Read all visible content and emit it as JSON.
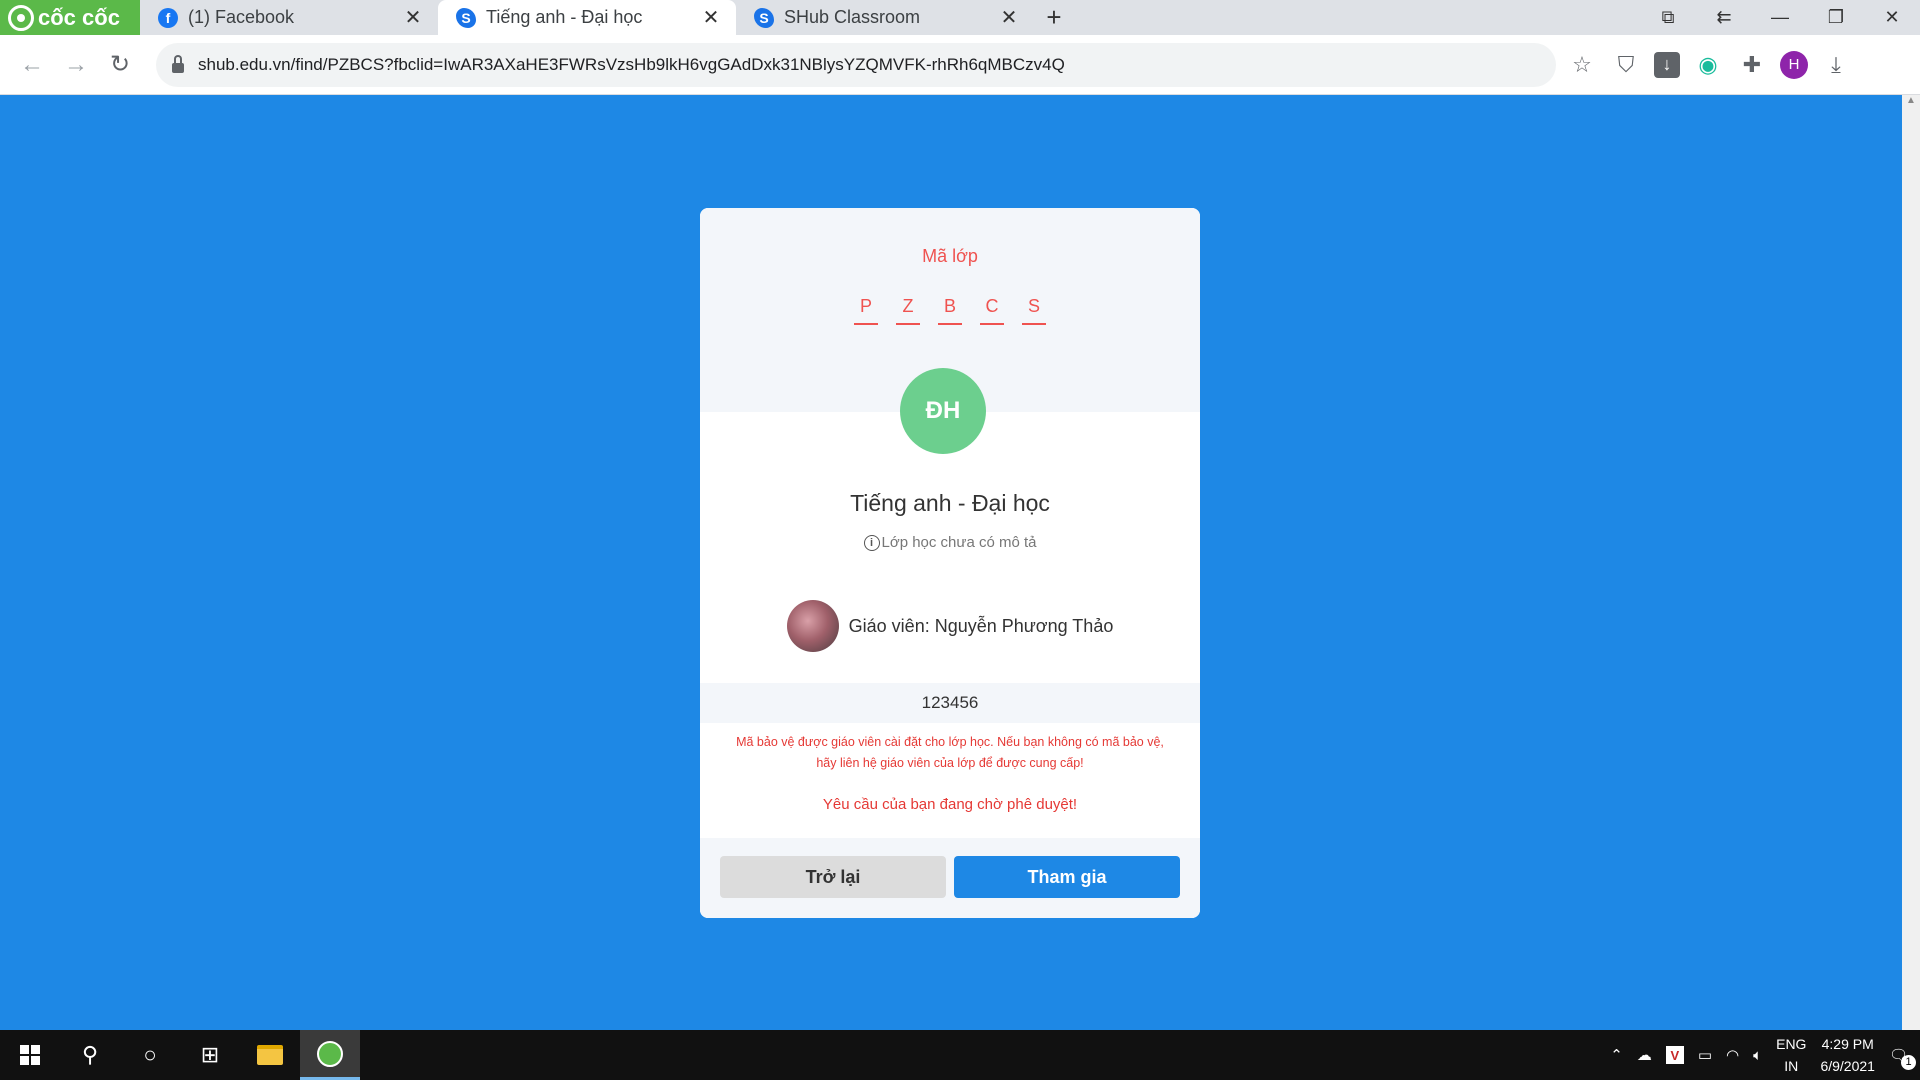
{
  "browser": {
    "brand": "cốc cốc",
    "tabs": [
      {
        "title": "(1) Facebook",
        "favicon": "facebook-icon",
        "active": false
      },
      {
        "title": "Tiếng anh - Đại học",
        "favicon": "shub-icon",
        "active": true
      },
      {
        "title": "SHub Classroom",
        "favicon": "shub-icon",
        "active": false
      }
    ],
    "url": "shub.edu.vn/find/PZBCS?fbclid=IwAR3AXaHE3FWRsVzsHb9lkH6vgGAdDxk31NBlysYZQMVFK-rhRh6qMBCzv4Q",
    "profile_initial": "H",
    "colors": {
      "brand": "#5bb949",
      "page_bg": "#1e88e5"
    }
  },
  "card": {
    "code_label": "Mã lớp",
    "code_chars": [
      "P",
      "Z",
      "B",
      "C",
      "S"
    ],
    "avatar_initials": "ĐH",
    "class_name": "Tiếng anh - Đại học",
    "class_desc": "Lớp học chưa có mô tả",
    "teacher": "Giáo viên: Nguyễn Phương Thảo",
    "password_value": "123456",
    "warning": "Mã bảo vệ được giáo viên cài đặt cho lớp học. Nếu bạn không có mã bảo vệ, hãy liên hệ giáo viên của lớp để được cung cấp!",
    "pending": "Yêu cầu của bạn đang chờ phê duyệt!",
    "back_label": "Trở lại",
    "join_label": "Tham gia",
    "colors": {
      "accent": "#ef5350",
      "avatar": "#6ccf8e",
      "button": "#1e88e5"
    }
  },
  "taskbar": {
    "lang_line1": "ENG",
    "lang_line2": "IN",
    "time": "4:29 PM",
    "date": "6/9/2021",
    "notification_count": "1"
  }
}
